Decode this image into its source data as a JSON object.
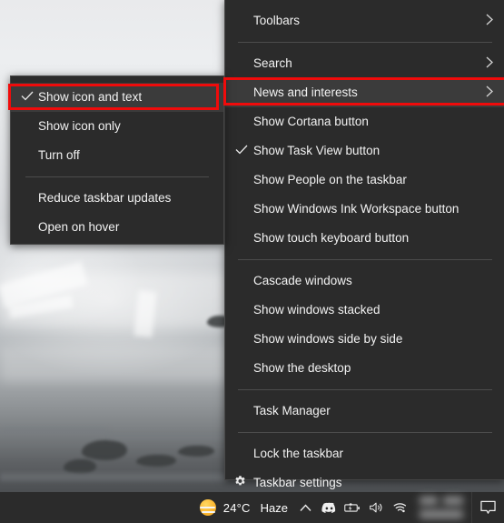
{
  "desktop": {
    "wallpaper_description": "foggy misty coastal landscape with dark rocks"
  },
  "taskbar": {
    "weather": {
      "icon": "sun-haze-icon",
      "temperature": "24°C",
      "condition": "Haze"
    },
    "tray": [
      {
        "name": "show-hidden-icons-icon",
        "glyph": "chevron-up"
      },
      {
        "name": "discord-icon",
        "glyph": "discord"
      },
      {
        "name": "battery-charging-icon",
        "glyph": "battery"
      },
      {
        "name": "volume-icon",
        "glyph": "speaker"
      },
      {
        "name": "wifi-icon",
        "glyph": "wifi"
      }
    ],
    "clock": {
      "label": "",
      "obscured": true
    },
    "action_center": {
      "name": "action-center-icon",
      "label": ""
    }
  },
  "context_menu": {
    "title": "Taskbar context menu",
    "items": [
      {
        "label": "Toolbars",
        "submenu": true,
        "checked": false,
        "icon": null,
        "separator_after": true
      },
      {
        "label": "Search",
        "submenu": true,
        "checked": false,
        "icon": null,
        "separator_after": false
      },
      {
        "label": "News and interests",
        "submenu": true,
        "checked": false,
        "icon": null,
        "separator_after": false,
        "highlighted": true
      },
      {
        "label": "Show Cortana button",
        "submenu": false,
        "checked": false,
        "icon": null,
        "separator_after": false
      },
      {
        "label": "Show Task View button",
        "submenu": false,
        "checked": true,
        "icon": null,
        "separator_after": false
      },
      {
        "label": "Show People on the taskbar",
        "submenu": false,
        "checked": false,
        "icon": null,
        "separator_after": false
      },
      {
        "label": "Show Windows Ink Workspace button",
        "submenu": false,
        "checked": false,
        "icon": null,
        "separator_after": false
      },
      {
        "label": "Show touch keyboard button",
        "submenu": false,
        "checked": false,
        "icon": null,
        "separator_after": true
      },
      {
        "label": "Cascade windows",
        "submenu": false,
        "checked": false,
        "icon": null,
        "separator_after": false
      },
      {
        "label": "Show windows stacked",
        "submenu": false,
        "checked": false,
        "icon": null,
        "separator_after": false
      },
      {
        "label": "Show windows side by side",
        "submenu": false,
        "checked": false,
        "icon": null,
        "separator_after": false
      },
      {
        "label": "Show the desktop",
        "submenu": false,
        "checked": false,
        "icon": null,
        "separator_after": true
      },
      {
        "label": "Task Manager",
        "submenu": false,
        "checked": false,
        "icon": null,
        "separator_after": true
      },
      {
        "label": "Lock the taskbar",
        "submenu": false,
        "checked": false,
        "icon": null,
        "separator_after": false
      },
      {
        "label": "Taskbar settings",
        "submenu": false,
        "checked": false,
        "icon": "gear-icon",
        "separator_after": false
      }
    ]
  },
  "submenu": {
    "title": "News and interests submenu",
    "items": [
      {
        "label": "Show icon and text",
        "checked": true,
        "separator_after": false,
        "highlighted": true
      },
      {
        "label": "Show icon only",
        "checked": false,
        "separator_after": false
      },
      {
        "label": "Turn off",
        "checked": false,
        "separator_after": true
      },
      {
        "label": "Reduce taskbar updates",
        "checked": false,
        "separator_after": false
      },
      {
        "label": "Open on hover",
        "checked": false,
        "separator_after": false
      }
    ]
  },
  "annotations": {
    "color": "#f00b0b",
    "boxes": [
      {
        "name": "highlight-show-icon-and-text"
      },
      {
        "name": "highlight-news-and-interests"
      }
    ]
  }
}
